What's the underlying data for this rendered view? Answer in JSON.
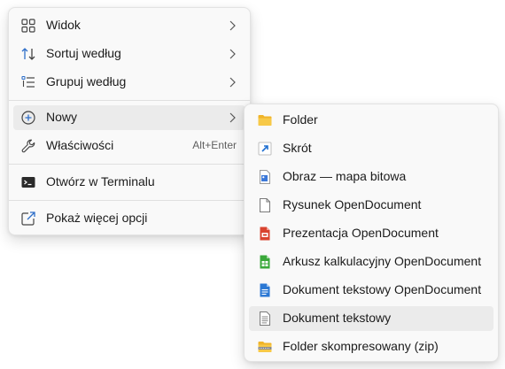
{
  "main_menu": {
    "items": [
      {
        "label": "Widok",
        "icon": "grid-icon",
        "has_submenu": true
      },
      {
        "label": "Sortuj według",
        "icon": "sort-icon",
        "has_submenu": true
      },
      {
        "label": "Grupuj według",
        "icon": "group-icon",
        "has_submenu": true
      },
      {
        "label": "Nowy",
        "icon": "add-circle-icon",
        "has_submenu": true,
        "highlighted": true
      },
      {
        "label": "Właściwości",
        "icon": "wrench-icon",
        "shortcut": "Alt+Enter"
      },
      {
        "label": "Otwórz w Terminalu",
        "icon": "terminal-icon"
      },
      {
        "label": "Pokaż więcej opcji",
        "icon": "share-icon"
      }
    ]
  },
  "new_submenu": {
    "items": [
      {
        "label": "Folder",
        "icon": "folder-icon"
      },
      {
        "label": "Skrót",
        "icon": "shortcut-icon"
      },
      {
        "label": "Obraz — mapa bitowa",
        "icon": "bitmap-icon"
      },
      {
        "label": "Rysunek OpenDocument",
        "icon": "drawing-icon"
      },
      {
        "label": "Prezentacja OpenDocument",
        "icon": "presentation-icon"
      },
      {
        "label": "Arkusz kalkulacyjny OpenDocument",
        "icon": "spreadsheet-icon"
      },
      {
        "label": "Dokument tekstowy OpenDocument",
        "icon": "text-document-icon"
      },
      {
        "label": "Dokument tekstowy",
        "icon": "plain-text-icon",
        "highlighted": true
      },
      {
        "label": "Folder skompresowany (zip)",
        "icon": "zip-folder-icon"
      }
    ]
  },
  "colors": {
    "menu_bg": "#f9f9f9",
    "hover_bg": "#ebebeb",
    "folder_yellow": "#f7c948",
    "accent_blue": "#1f6fd1",
    "presentation_red": "#d9432f",
    "spreadsheet_green": "#3aa83a"
  }
}
